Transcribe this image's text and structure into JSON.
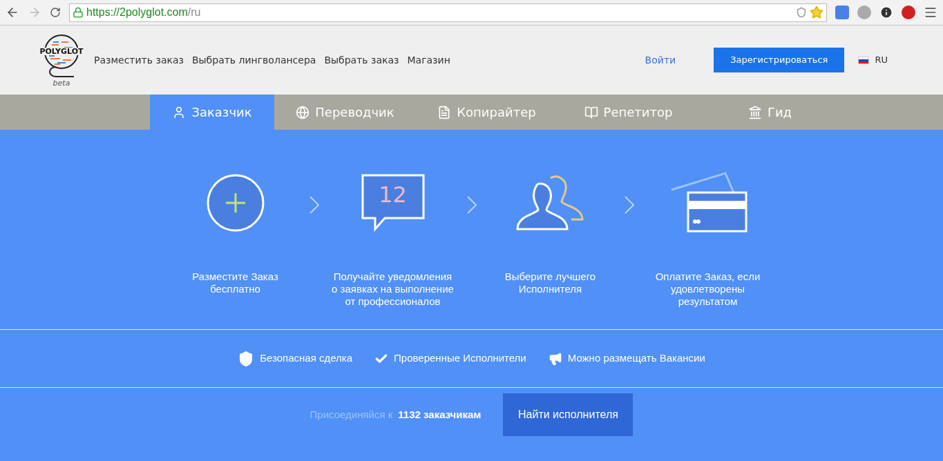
{
  "browser": {
    "url_host": "https://2polyglot.com",
    "url_path": "/ru"
  },
  "header": {
    "logo": {
      "name": "POLYGLOT",
      "badge": "beta"
    },
    "nav": [
      "Разместить заказ",
      "Выбрать лингволансера",
      "Выбрать заказ",
      "Магазин"
    ],
    "login": "Войти",
    "register": "Зарегистрироваться",
    "language": "RU"
  },
  "tabs": [
    {
      "kind": "client",
      "label": "Заказчик",
      "selected": true
    },
    {
      "kind": "translator",
      "label": "Переводчик",
      "selected": false
    },
    {
      "kind": "copywriter",
      "label": "Копирайтер",
      "selected": false
    },
    {
      "kind": "tutor",
      "label": "Репетитор",
      "selected": false
    },
    {
      "kind": "guide",
      "label": "Гид",
      "selected": false
    }
  ],
  "steps": [
    {
      "kind": "plus",
      "caption": "Разместите Заказ бесплатно"
    },
    {
      "kind": "bubble",
      "badge": "12",
      "caption": "Получайте уведомления о заявках на выполнение от профессионалов"
    },
    {
      "kind": "people",
      "caption": "Выберите лучшего Исполнителя"
    },
    {
      "kind": "card",
      "caption": "Оплатите Заказ, если удовлетворены результатом"
    }
  ],
  "features": [
    {
      "kind": "shield",
      "label": "Безопасная сделка"
    },
    {
      "kind": "check",
      "label": "Проверенные Исполнители"
    },
    {
      "kind": "megaphone",
      "label": "Можно размещать Вакансии"
    }
  ],
  "join": {
    "prefix": "Присоединяйся к",
    "count": "1132 заказчикам",
    "button": "Найти исполнителя"
  }
}
